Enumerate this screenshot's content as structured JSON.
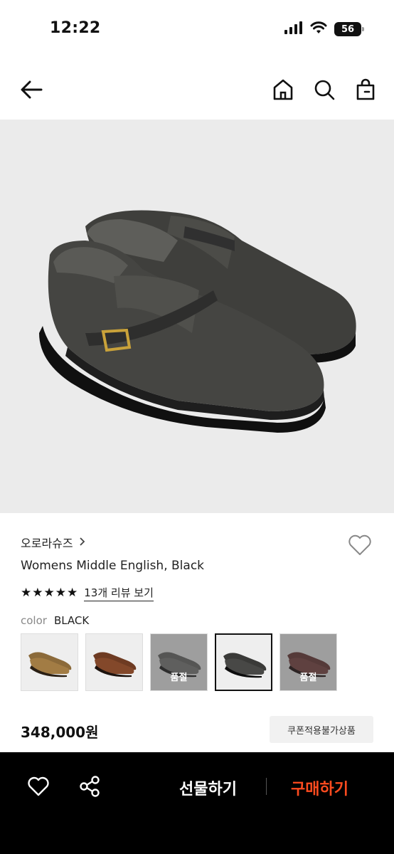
{
  "status_bar": {
    "time": "12:22",
    "battery": "56"
  },
  "nav": {
    "back_icon": "arrow-left-icon",
    "icons": [
      "home-icon",
      "search-icon",
      "shopping-bag-icon"
    ]
  },
  "product": {
    "brand": "오로라슈즈",
    "name": "Womens Middle English, Black",
    "rating_stars": 5,
    "review_link": "13개 리뷰 보기",
    "color_label": "color",
    "color_value": "BLACK",
    "swatches": [
      {
        "color": "tan",
        "sold_out": false,
        "selected": false
      },
      {
        "color": "brown",
        "sold_out": false,
        "selected": false
      },
      {
        "color": "grey",
        "sold_out": true,
        "selected": false,
        "label": "품절"
      },
      {
        "color": "black",
        "sold_out": false,
        "selected": true
      },
      {
        "color": "burgundy",
        "sold_out": true,
        "selected": false,
        "label": "품절"
      }
    ],
    "price": "348,000원",
    "coupon_badge": "쿠폰적용불가상품"
  },
  "bottom_bar": {
    "gift_label": "선물하기",
    "buy_label": "구매하기",
    "accent_color": "#ff4b1f"
  }
}
